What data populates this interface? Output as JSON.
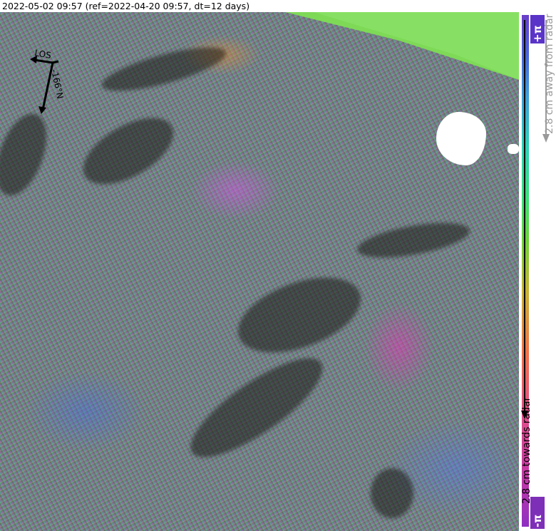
{
  "title": "2022-05-02 09:57 (ref=2022-04-20 09:57, dt=12 days)",
  "compass": {
    "los_label": "LOS",
    "heading_label": "-166°N"
  },
  "colorbar": {
    "top_label": "+π",
    "bottom_label": "-π",
    "away_label": "2.8 cm away from radar",
    "towards_label": "2.8 cm towards radar"
  },
  "colors": {
    "no_data": "#ffffff",
    "outside_coverage": "#7ed957",
    "colorbar_top": "#6a3fc8",
    "colorbar_bottom": "#8e2fc2"
  }
}
